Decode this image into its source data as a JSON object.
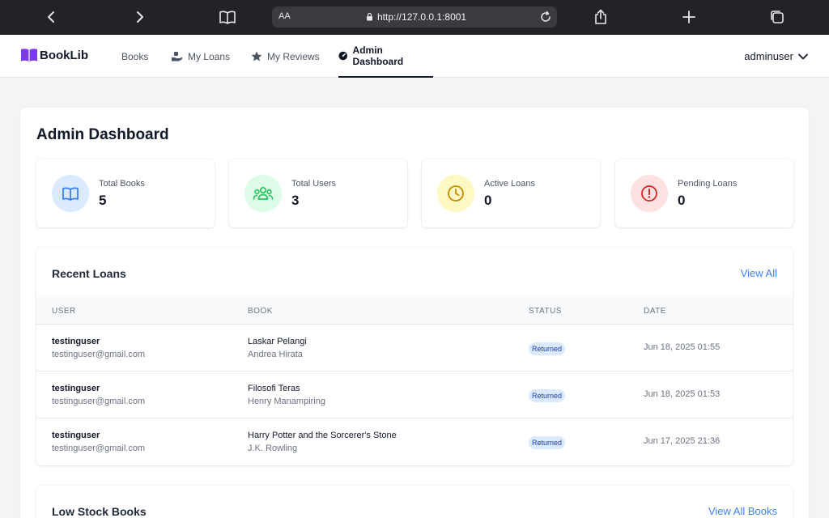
{
  "browser": {
    "aa_label": "AA",
    "url": "http://127.0.0.1:8001"
  },
  "nav": {
    "brand": "BookLib",
    "items": [
      {
        "label": "Books",
        "icon": "none"
      },
      {
        "label": "My Loans",
        "icon": "hand-icon"
      },
      {
        "label": "My Reviews",
        "icon": "star-icon"
      },
      {
        "label": "Admin Dashboard",
        "icon": "gauge-icon",
        "active": true
      }
    ],
    "user": "adminuser"
  },
  "page": {
    "title": "Admin Dashboard"
  },
  "stats": [
    {
      "label": "Total Books",
      "value": "5",
      "icon": "book-icon",
      "color": "#3b82f6",
      "bg": "#dbeafe"
    },
    {
      "label": "Total Users",
      "value": "3",
      "icon": "users-icon",
      "color": "#22c55e",
      "bg": "#dcfce7"
    },
    {
      "label": "Active Loans",
      "value": "0",
      "icon": "clock-icon",
      "color": "#ca8a04",
      "bg": "#fef9c3"
    },
    {
      "label": "Pending Loans",
      "value": "0",
      "icon": "alert-icon",
      "color": "#dc2626",
      "bg": "#fee2e2"
    }
  ],
  "recent_loans": {
    "title": "Recent Loans",
    "view_all": "View All",
    "columns": [
      "USER",
      "BOOK",
      "STATUS",
      "DATE"
    ],
    "rows": [
      {
        "user": "testinguser",
        "email": "testinguser@gmail.com",
        "book": "Laskar Pelangi",
        "author": "Andrea Hirata",
        "status": "Returned",
        "date": "Jun 18, 2025 01:55"
      },
      {
        "user": "testinguser",
        "email": "testinguser@gmail.com",
        "book": "Filosofi Teras",
        "author": "Henry Manampiring",
        "status": "Returned",
        "date": "Jun 18, 2025 01:53"
      },
      {
        "user": "testinguser",
        "email": "testinguser@gmail.com",
        "book": "Harry Potter and the Sorcerer's Stone",
        "author": "J.K. Rowling",
        "status": "Returned",
        "date": "Jun 17, 2025 21:36"
      }
    ]
  },
  "low_stock": {
    "title": "Low Stock Books",
    "view_all": "View All Books"
  }
}
